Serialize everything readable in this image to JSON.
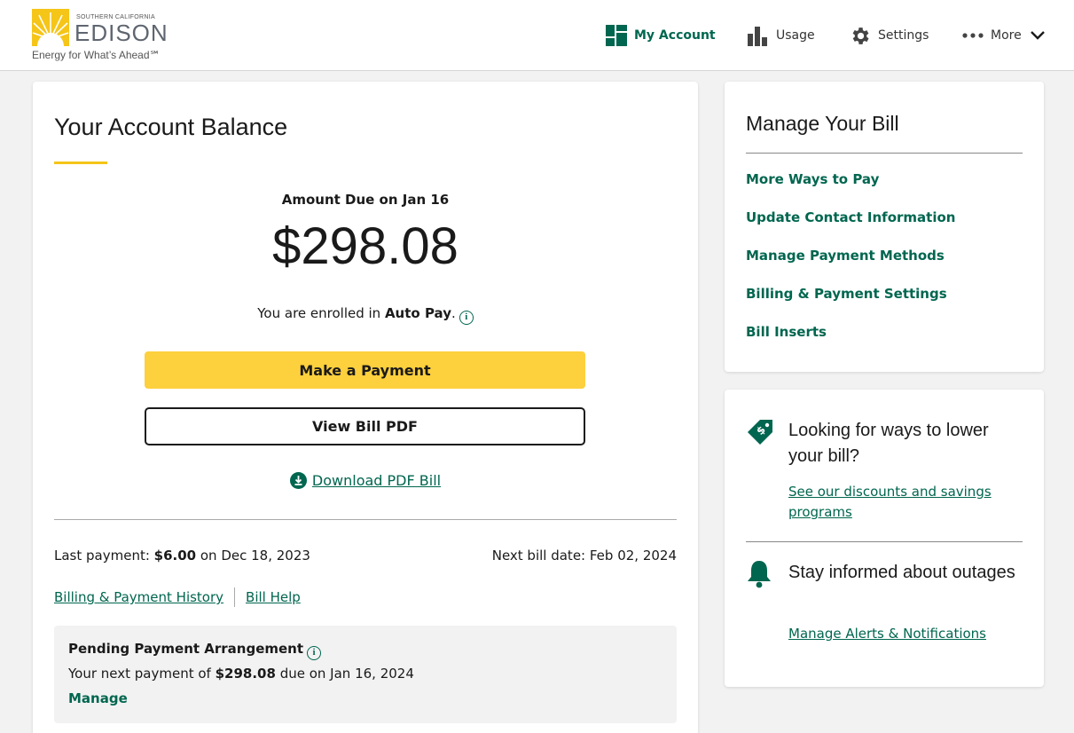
{
  "brand": {
    "small": "SOUTHERN CALIFORNIA",
    "name": "EDISON",
    "tagline": "Energy for What’s Ahead℠",
    "accent": "#f5c518",
    "green": "#00664f"
  },
  "nav": {
    "my_account": "My Account",
    "usage": "Usage",
    "settings": "Settings",
    "more": "More"
  },
  "balance": {
    "title": "Your Account Balance",
    "amount_label": "Amount Due on Jan 16",
    "amount": "$298.08",
    "autopay_prefix": "You are enrolled in ",
    "autopay_strong": "Auto Pay",
    "autopay_suffix": ".",
    "make_payment": "Make a Payment",
    "view_pdf": "View Bill PDF",
    "download_pdf": "Download PDF Bill",
    "last_payment_label": "Last payment: ",
    "last_payment_amount": "$6.00",
    "last_payment_date": " on Dec 18, 2023",
    "next_bill": "Next bill date: Feb 02, 2024",
    "history_link": "Billing & Payment History",
    "help_link": "Bill Help"
  },
  "pending": {
    "title": "Pending Payment Arrangement",
    "text_prefix": "Your next payment of ",
    "text_amount": "$298.08",
    "text_suffix": " due on Jan 16, 2024",
    "manage": "Manage"
  },
  "manage_bill": {
    "title": "Manage Your Bill",
    "items": [
      "More Ways to Pay",
      "Update Contact Information",
      "Manage Payment Methods",
      "Billing & Payment Settings",
      "Bill Inserts"
    ]
  },
  "promo": {
    "savings_heading": "Looking for ways to lower your bill?",
    "savings_link": "See our discounts and savings programs",
    "outage_heading": "Stay informed about outages",
    "outage_link": "Manage Alerts & Notifications"
  }
}
